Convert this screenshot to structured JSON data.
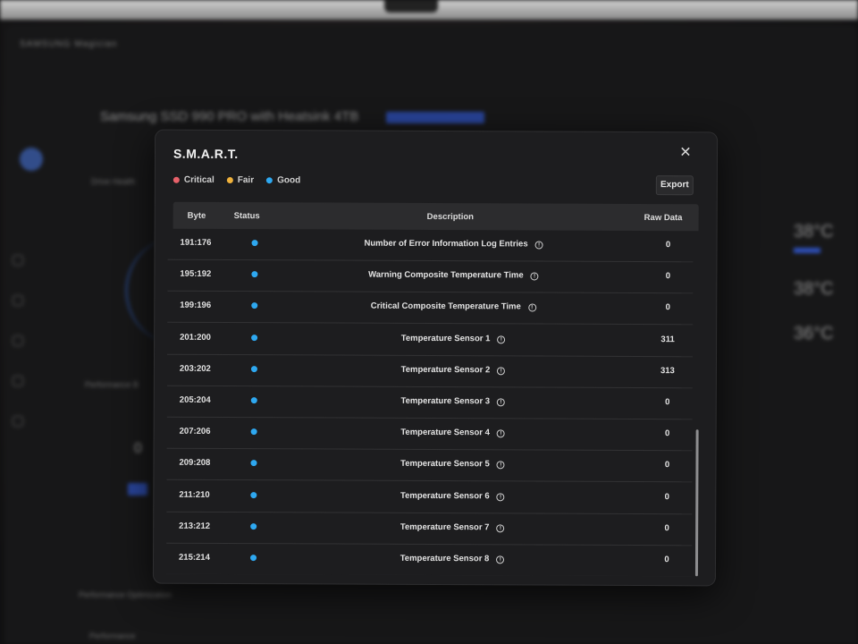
{
  "background": {
    "brand": "SAMSUNG Magician",
    "drive_title": "Samsung SSD 990 PRO with Heatsink 4TB",
    "drive_health_label": "Drive Health",
    "performance_label": "Performance B",
    "perf_optimization_label": "Performance Optimization",
    "performance_label_2": "Performance",
    "big_value": "0",
    "temps": [
      "38°C",
      "38°C",
      "36°C"
    ]
  },
  "modal": {
    "title": "S.M.A.R.T.",
    "close_glyph": "✕",
    "export_label": "Export",
    "legend": [
      {
        "label": "Critical",
        "color": "#e8616a"
      },
      {
        "label": "Fair",
        "color": "#f0b23c"
      },
      {
        "label": "Good",
        "color": "#2ea8f0"
      }
    ],
    "columns": {
      "byte": "Byte",
      "status": "Status",
      "description": "Description",
      "raw": "Raw Data"
    },
    "rows": [
      {
        "byte": "191:176",
        "status": "good",
        "description": "Number of Error Information Log Entries",
        "raw": "0"
      },
      {
        "byte": "195:192",
        "status": "good",
        "description": "Warning Composite Temperature Time",
        "raw": "0"
      },
      {
        "byte": "199:196",
        "status": "good",
        "description": "Critical Composite Temperature Time",
        "raw": "0"
      },
      {
        "byte": "201:200",
        "status": "good",
        "description": "Temperature Sensor 1",
        "raw": "311"
      },
      {
        "byte": "203:202",
        "status": "good",
        "description": "Temperature Sensor 2",
        "raw": "313"
      },
      {
        "byte": "205:204",
        "status": "good",
        "description": "Temperature Sensor 3",
        "raw": "0"
      },
      {
        "byte": "207:206",
        "status": "good",
        "description": "Temperature Sensor 4",
        "raw": "0"
      },
      {
        "byte": "209:208",
        "status": "good",
        "description": "Temperature Sensor 5",
        "raw": "0"
      },
      {
        "byte": "211:210",
        "status": "good",
        "description": "Temperature Sensor 6",
        "raw": "0"
      },
      {
        "byte": "213:212",
        "status": "good",
        "description": "Temperature Sensor 7",
        "raw": "0"
      },
      {
        "byte": "215:214",
        "status": "good",
        "description": "Temperature Sensor 8",
        "raw": "0"
      }
    ],
    "status_colors": {
      "good": "#2ea8f0",
      "fair": "#f0b23c",
      "critical": "#e8616a"
    },
    "info_icon": "info-circle-icon"
  }
}
